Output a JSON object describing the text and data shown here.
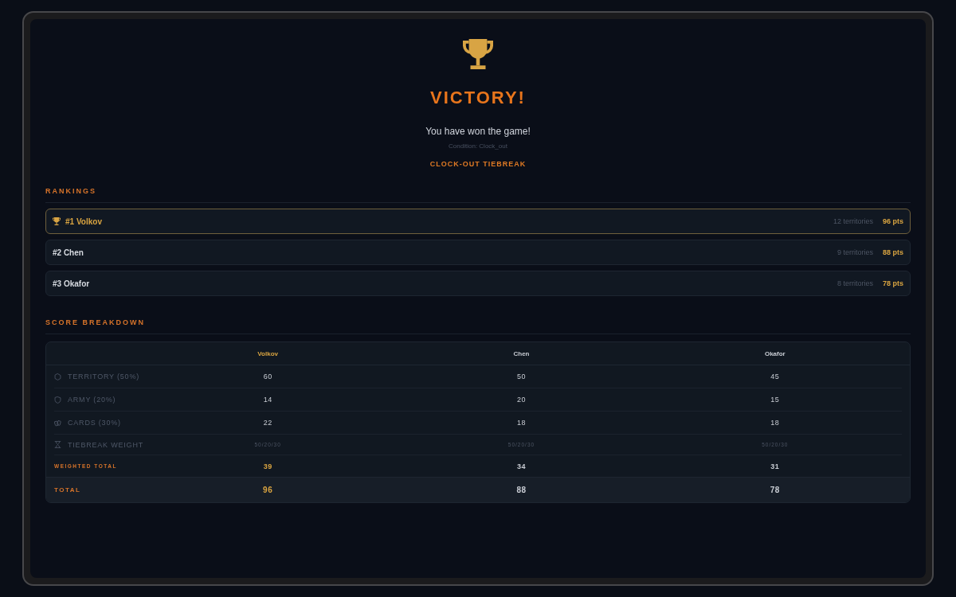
{
  "header": {
    "title": "VICTORY!",
    "message": "You have won the game!",
    "condition": "Condition: Clock_out",
    "badge": "CLOCK-OUT TIEBREAK"
  },
  "rankings": {
    "title": "RANKINGS",
    "rows": [
      {
        "rank": "#1 Volkov",
        "territories": "12 territories",
        "points": "96 pts",
        "winner": true
      },
      {
        "rank": "#2 Chen",
        "territories": "9 territories",
        "points": "88 pts",
        "winner": false
      },
      {
        "rank": "#3 Okafor",
        "territories": "8 territories",
        "points": "78 pts",
        "winner": false
      }
    ]
  },
  "score_breakdown": {
    "title": "SCORE BREAKDOWN",
    "columns": [
      {
        "label": "Volkov",
        "winner": true
      },
      {
        "label": "Chen",
        "winner": false
      },
      {
        "label": "Okafor",
        "winner": false
      }
    ],
    "rows": [
      {
        "kind": "territory",
        "label": "TERRITORY (50%)",
        "values": [
          "60",
          "50",
          "45"
        ]
      },
      {
        "kind": "army",
        "label": "ARMY (20%)",
        "values": [
          "14",
          "20",
          "15"
        ]
      },
      {
        "kind": "cards",
        "label": "CARDS (30%)",
        "values": [
          "22",
          "18",
          "18"
        ]
      },
      {
        "kind": "tiebreak",
        "label": "TIEBREAK WEIGHT",
        "values": [
          "50/20/30",
          "50/20/30",
          "50/20/30"
        ]
      },
      {
        "kind": "weighted",
        "label": "WEIGHTED TOTAL",
        "values": [
          "39",
          "34",
          "31"
        ]
      },
      {
        "kind": "total",
        "label": "TOTAL",
        "values": [
          "96",
          "88",
          "78"
        ]
      }
    ]
  }
}
